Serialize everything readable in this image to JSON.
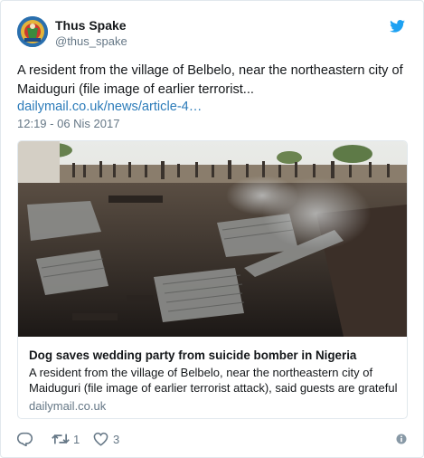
{
  "author": {
    "name": "Thus Spake",
    "handle": "@thus_spake"
  },
  "tweet": {
    "text": "A resident from the village of Belbelo, near the northeastern city of Maiduguri (file image of earlier terrorist...",
    "link_text": "dailymail.co.uk/news/article-4…",
    "timestamp": "12:19 - 06 Nis 2017"
  },
  "card": {
    "title": "Dog saves wedding party from suicide bomber in Nigeria",
    "description": "A resident from the village of Belbelo, near the northeastern city of Maiduguri (file image of earlier terrorist attack), said guests are grateful",
    "domain": "dailymail.co.uk"
  },
  "actions": {
    "retweet_count": "1",
    "like_count": "3"
  },
  "icons": {
    "brand": "twitter-bird-icon",
    "reply": "reply-icon",
    "retweet": "retweet-icon",
    "like": "heart-icon",
    "info": "info-icon"
  },
  "colors": {
    "brand_blue": "#1da1f2",
    "link_blue": "#2b7bb9",
    "muted_gray": "#657786",
    "text": "#14171a",
    "border": "#e1e8ed"
  }
}
